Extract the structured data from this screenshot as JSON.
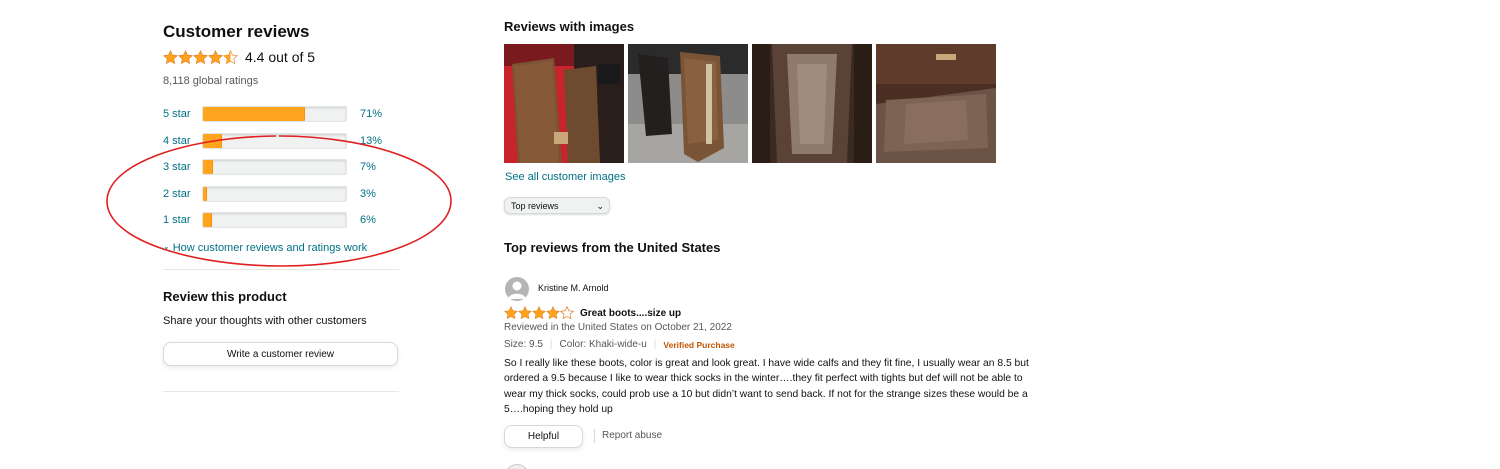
{
  "customer_reviews": {
    "title": "Customer reviews",
    "rating_value": 4.4,
    "rating_text": "4.4 out of 5",
    "global_ratings": "8,118 global ratings",
    "histogram": [
      {
        "label": "5 star",
        "percent_text": "71%",
        "fraction": 0.71
      },
      {
        "label": "4 star",
        "percent_text": "13%",
        "fraction": 0.13
      },
      {
        "label": "3 star",
        "percent_text": "7%",
        "fraction": 0.07
      },
      {
        "label": "2 star",
        "percent_text": "3%",
        "fraction": 0.03
      },
      {
        "label": "1 star",
        "percent_text": "6%",
        "fraction": 0.06
      }
    ],
    "how_link": "How customer reviews and ratings work"
  },
  "review_product": {
    "title": "Review this product",
    "subtitle": "Share your thoughts with other customers",
    "button_label": "Write a customer review"
  },
  "reviews_with_images": {
    "title": "Reviews with images",
    "see_all_link": "See all customer images"
  },
  "sort": {
    "selected": "Top reviews"
  },
  "top_reviews": {
    "title": "Top reviews from the United States",
    "review": {
      "reviewer": "Kristine M. Arnold",
      "star_rating": 4,
      "headline": "Great boots....size up",
      "reviewed_on": "Reviewed in the United States on October 21, 2022",
      "size": "Size: 9.5",
      "color": "Color: Khaki-wide-u",
      "verified": "Verified Purchase",
      "body": "So I really like these boots, color is great and look great. I have wide calfs and they fit fine, I usually wear an 8.5 but ordered a 9.5 because I like to wear thick socks in the winter….they fit perfect with tights but def will not be able to wear my thick socks, could prob use a 10 but didn’t want to send back. If not for the strange sizes these would be a 5….hoping they hold up",
      "helpful_label": "Helpful",
      "report_label": "Report abuse"
    }
  },
  "colors": {
    "star": "#FFA41C",
    "link": "#007185",
    "verified": "#C45500",
    "annotation": "#E02020"
  },
  "icons": [
    "star-icon",
    "half-star-icon",
    "chevron-down-icon",
    "avatar-icon"
  ]
}
